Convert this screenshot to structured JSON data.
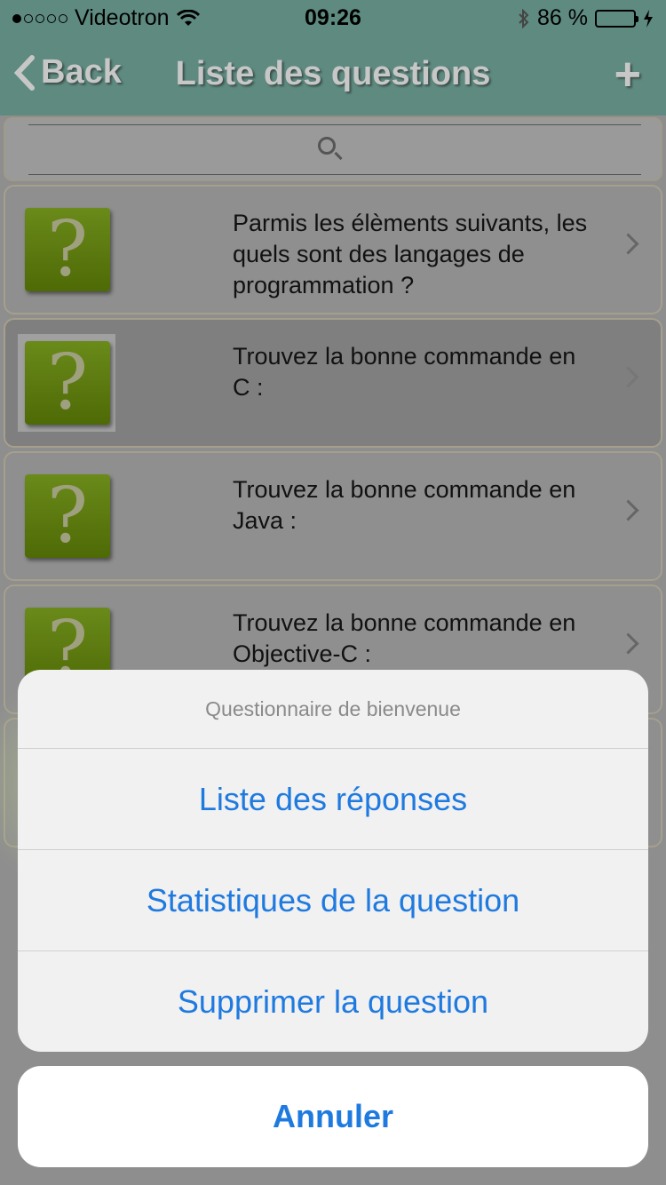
{
  "status_bar": {
    "carrier": "Videotron",
    "time": "09:26",
    "battery_percent": "86 %",
    "battery_level": 0.86
  },
  "nav": {
    "back_label": "Back",
    "title": "Liste des questions",
    "add_label": "+"
  },
  "questions": [
    {
      "text": "Parmis les élèments suivants, les quels sont des langages de programmation ?"
    },
    {
      "text": "Trouvez la bonne commande en C :"
    },
    {
      "text": "Trouvez la bonne commande en Java :"
    },
    {
      "text": "Trouvez la bonne commande en Objective-C :"
    }
  ],
  "action_sheet": {
    "title": "Questionnaire de bienvenue",
    "items": [
      "Liste des réponses",
      "Statistiques de la question",
      "Supprimer la question"
    ],
    "cancel": "Annuler"
  },
  "colors": {
    "nav_bg": "#5e8a80",
    "action_blue": "#1f7ae0",
    "icon_green": "#5a7a10"
  }
}
